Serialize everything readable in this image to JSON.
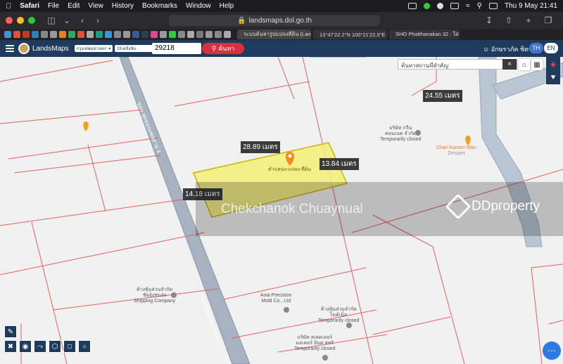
{
  "os_menubar": {
    "app": "Safari",
    "menus": [
      "File",
      "Edit",
      "View",
      "History",
      "Bookmarks",
      "Window",
      "Help"
    ],
    "clock": "Thu 9 May  21:41"
  },
  "browser": {
    "url": "landsmaps.dol.go.th",
    "tabs": [
      {
        "title": "ระบบค้นหารูปแปลงที่ดิน (LandsMa..."
      },
      {
        "title": "13°47'22.2\"N 100°21'22.5\"E - ..."
      },
      {
        "title": "SHO Phatthanakan 32 : ใส่ พัฒ..."
      }
    ]
  },
  "app": {
    "brand": "LandsMaps",
    "province": "กรุงเทพมหานคร",
    "district": "19-ตลิ่งชัน",
    "parcel_number": "29218",
    "search_label": "ค้นหา",
    "user_name": "อักษราภัค ชิตร",
    "lang_th": "TH",
    "lang_en": "EN"
  },
  "map": {
    "search_placeholder": "ค้นหาสถานที่สำคัญ",
    "search_clear": "×",
    "measurements": {
      "top": "28.89 เมตร",
      "right": "13.84 เมตร",
      "left": "14.18 เมตร",
      "far": "24.55 เมตร"
    },
    "parcel_owner_label": "ตำแหน่ง-แปลง-ที่ดิน",
    "road_label_1": "ซอย พุทธมณฑลสาย 4",
    "road_label_2": "ซอย พุทธมณฑลสาย 4",
    "pois": [
      {
        "name": "บริษัท กรีน\nคอนเนค จำกัด",
        "status": "Temporarily closed"
      },
      {
        "name": "Chan Kanom Wan",
        "status": "Dessert"
      },
      {
        "name": "ห้างหุ้นส่วนจำกัด\nชัยอุ้งชนส่ง",
        "status": "Shipping Company"
      },
      {
        "name": "Asia Precision\nMold Co., Ltd",
        "status": ""
      },
      {
        "name": "ห้างหุ้นส่วนจำกัด\nไมค์เนิ่ม",
        "status": "Temporarily closed"
      },
      {
        "name": "บริษัท สเตคเลอร์\nมอเตอร์ อินด สทริ",
        "status": "Temporarily closed"
      }
    ],
    "watermark": {
      "agent": "Chekchanok Chuaynual",
      "brand": "DDproperty"
    },
    "colors": {
      "parcel_fill": "#f3f078",
      "parcel_stroke": "#c8b400",
      "boundary": "#e26060",
      "road": "#a7b3c0",
      "brand_navy": "#1e3a5c",
      "search_red": "#d9303f"
    }
  }
}
